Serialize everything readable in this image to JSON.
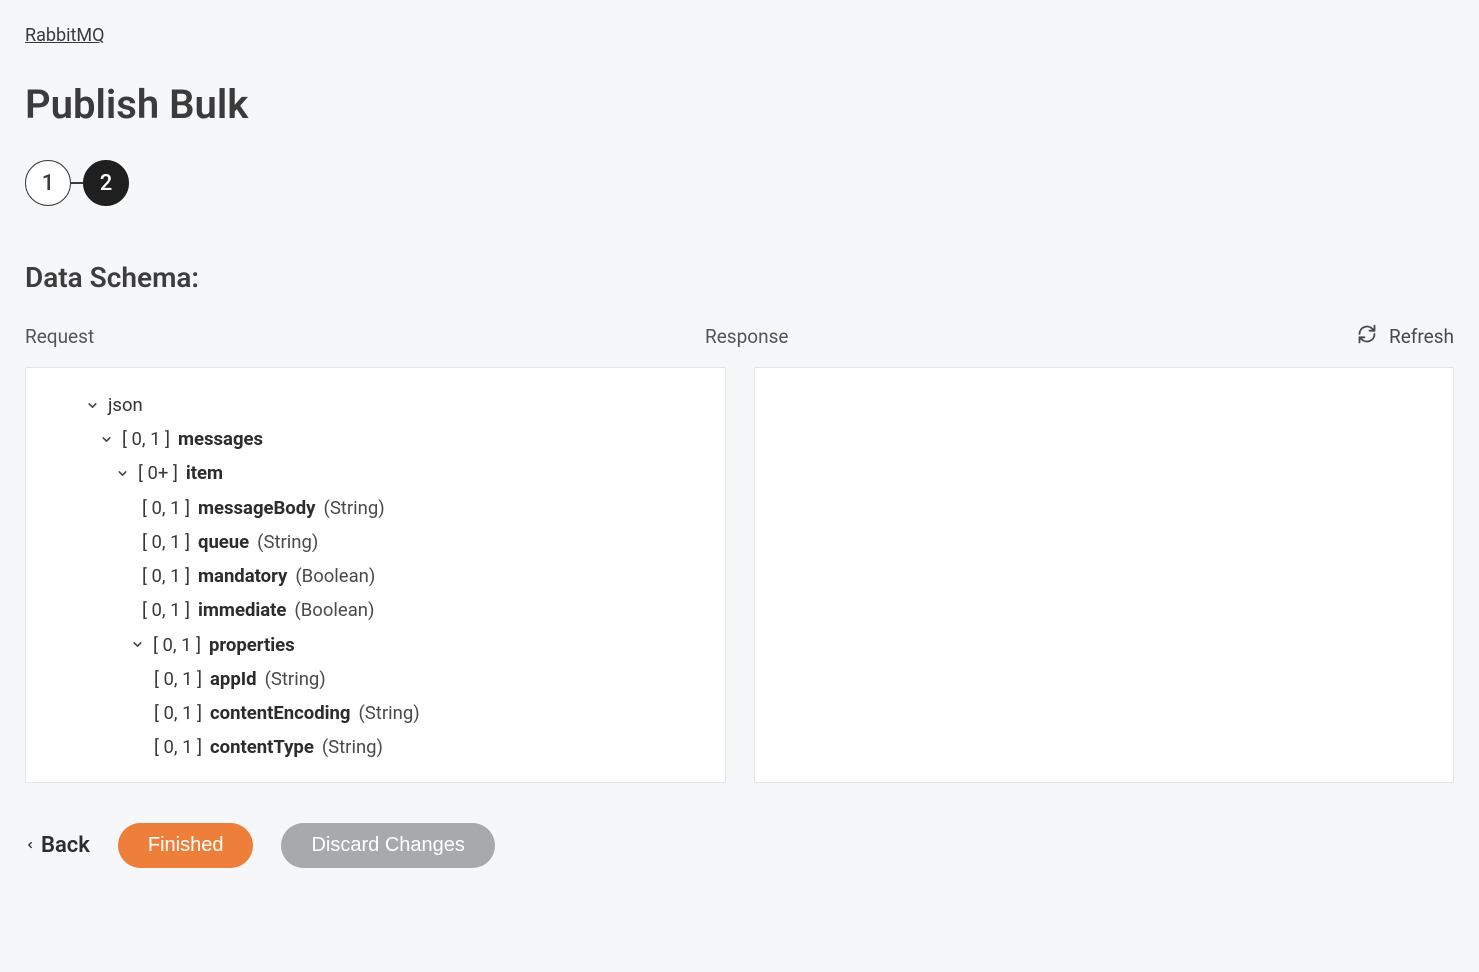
{
  "breadcrumb": {
    "label": "RabbitMQ"
  },
  "page": {
    "title": "Publish Bulk",
    "section_title": "Data Schema:"
  },
  "stepper": {
    "step1": "1",
    "step2": "2"
  },
  "labels": {
    "request": "Request",
    "response": "Response",
    "refresh": "Refresh"
  },
  "tree": {
    "root": {
      "label": "json"
    },
    "messages": {
      "card": "[ 0, 1 ]",
      "name": "messages"
    },
    "item": {
      "card": "[ 0+ ]",
      "name": "item"
    },
    "leaves": [
      {
        "card": "[ 0, 1 ]",
        "name": "messageBody",
        "type": "(String)"
      },
      {
        "card": "[ 0, 1 ]",
        "name": "queue",
        "type": "(String)"
      },
      {
        "card": "[ 0, 1 ]",
        "name": "mandatory",
        "type": "(Boolean)"
      },
      {
        "card": "[ 0, 1 ]",
        "name": "immediate",
        "type": "(Boolean)"
      }
    ],
    "properties": {
      "card": "[ 0, 1 ]",
      "name": "properties"
    },
    "propLeaves": [
      {
        "card": "[ 0, 1 ]",
        "name": "appId",
        "type": "(String)"
      },
      {
        "card": "[ 0, 1 ]",
        "name": "contentEncoding",
        "type": "(String)"
      },
      {
        "card": "[ 0, 1 ]",
        "name": "contentType",
        "type": "(String)"
      }
    ]
  },
  "footer": {
    "back": "Back",
    "finished": "Finished",
    "discard": "Discard Changes"
  }
}
